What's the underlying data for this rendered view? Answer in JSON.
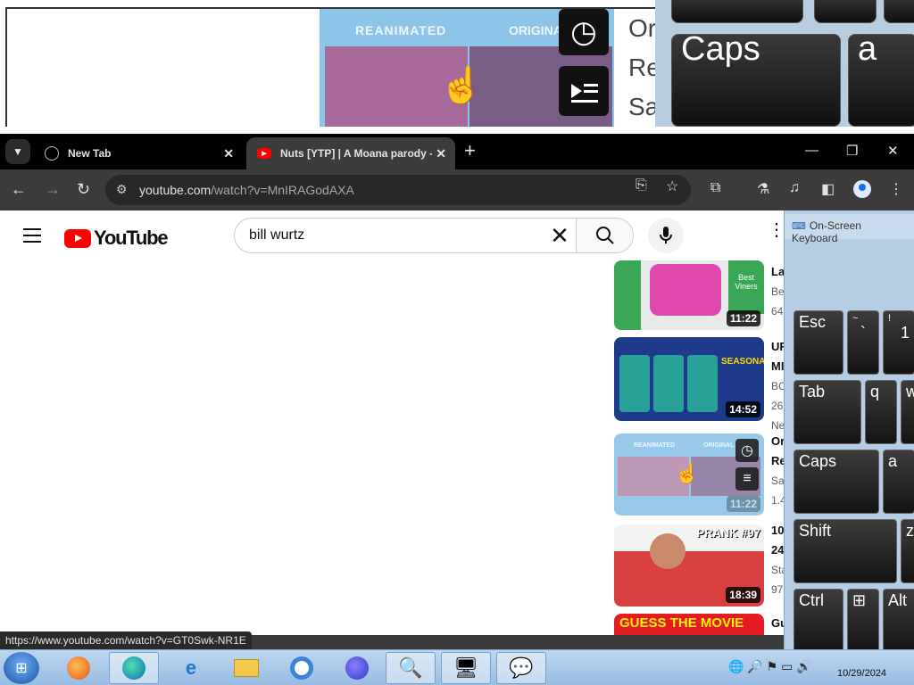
{
  "magnifier": {
    "thumb_label_left": "REANIMATED",
    "thumb_label_right": "ORIGINAL",
    "text_lines": [
      "Or",
      "Re",
      "Sa"
    ],
    "keys": [
      "Caps",
      "a"
    ]
  },
  "browser": {
    "tabs": [
      {
        "title": "New Tab",
        "favicon": "globe-icon"
      },
      {
        "title": "Nuts [YTP] | A Moana parody -",
        "favicon": "youtube-icon"
      }
    ],
    "new_tab": "+",
    "url_host": "youtube.com",
    "url_path": "/watch?v=MnIRAGodAXA",
    "window_controls": {
      "minimize": "—",
      "restore": "❐",
      "close": "✕"
    }
  },
  "youtube": {
    "logo_text": "YouTube",
    "search_value": "bill wurtz",
    "clear_icon": "✕",
    "more_icon": "⋮",
    "recommended": [
      {
        "duration": "11:22",
        "title_fragment": "La",
        "meta": [
          "Be",
          "64"
        ],
        "thumb_text": "Best Viners",
        "color": "#3aa757"
      },
      {
        "duration": "14:52",
        "title_fragment": "UF",
        "title_fragment2": "MI",
        "meta": [
          "BC",
          "26",
          "Ne"
        ],
        "thumb_text": "SEASONAL SH",
        "color": "#1e3a8a"
      },
      {
        "duration": "11:22",
        "title_fragment": "Or",
        "title_fragment2": "Re",
        "meta": [
          "Sa",
          "1.4"
        ],
        "thumb_text": "REANIMATED",
        "thumb_text2": "ORIGINAL",
        "color": "#8ec4e8"
      },
      {
        "duration": "18:39",
        "title_fragment": "10",
        "title_fragment2": "24",
        "meta": [
          "Sta",
          "97"
        ],
        "thumb_text": "PRANK #97",
        "color": "#d84040"
      },
      {
        "title_fragment": "Gu",
        "thumb_text": "GUESS THE MOVIE",
        "color": "#e51b24"
      }
    ]
  },
  "status_url": "https://www.youtube.com/watch?v=GT0Swk-NR1E",
  "osk": {
    "title": "On-Screen Keyboard",
    "keys": {
      "esc": "Esc",
      "tilde_top": "~",
      "tilde_bottom": "`",
      "one_top": "!",
      "one_bottom": "1",
      "tab": "Tab",
      "q": "q",
      "w": "w",
      "caps": "Caps",
      "a": "a",
      "shift": "Shift",
      "z": "z",
      "ctrl": "Ctrl",
      "win": "⊞",
      "alt": "Alt"
    }
  },
  "taskbar": {
    "clock_date": "10/29/2024",
    "apps": [
      "firefox-icon",
      "edge-icon",
      "ie-icon",
      "file-explorer-icon",
      "chromium-icon",
      "firefox-dev-icon",
      "search-tool-icon",
      "network-icon",
      "chat-icon"
    ]
  }
}
